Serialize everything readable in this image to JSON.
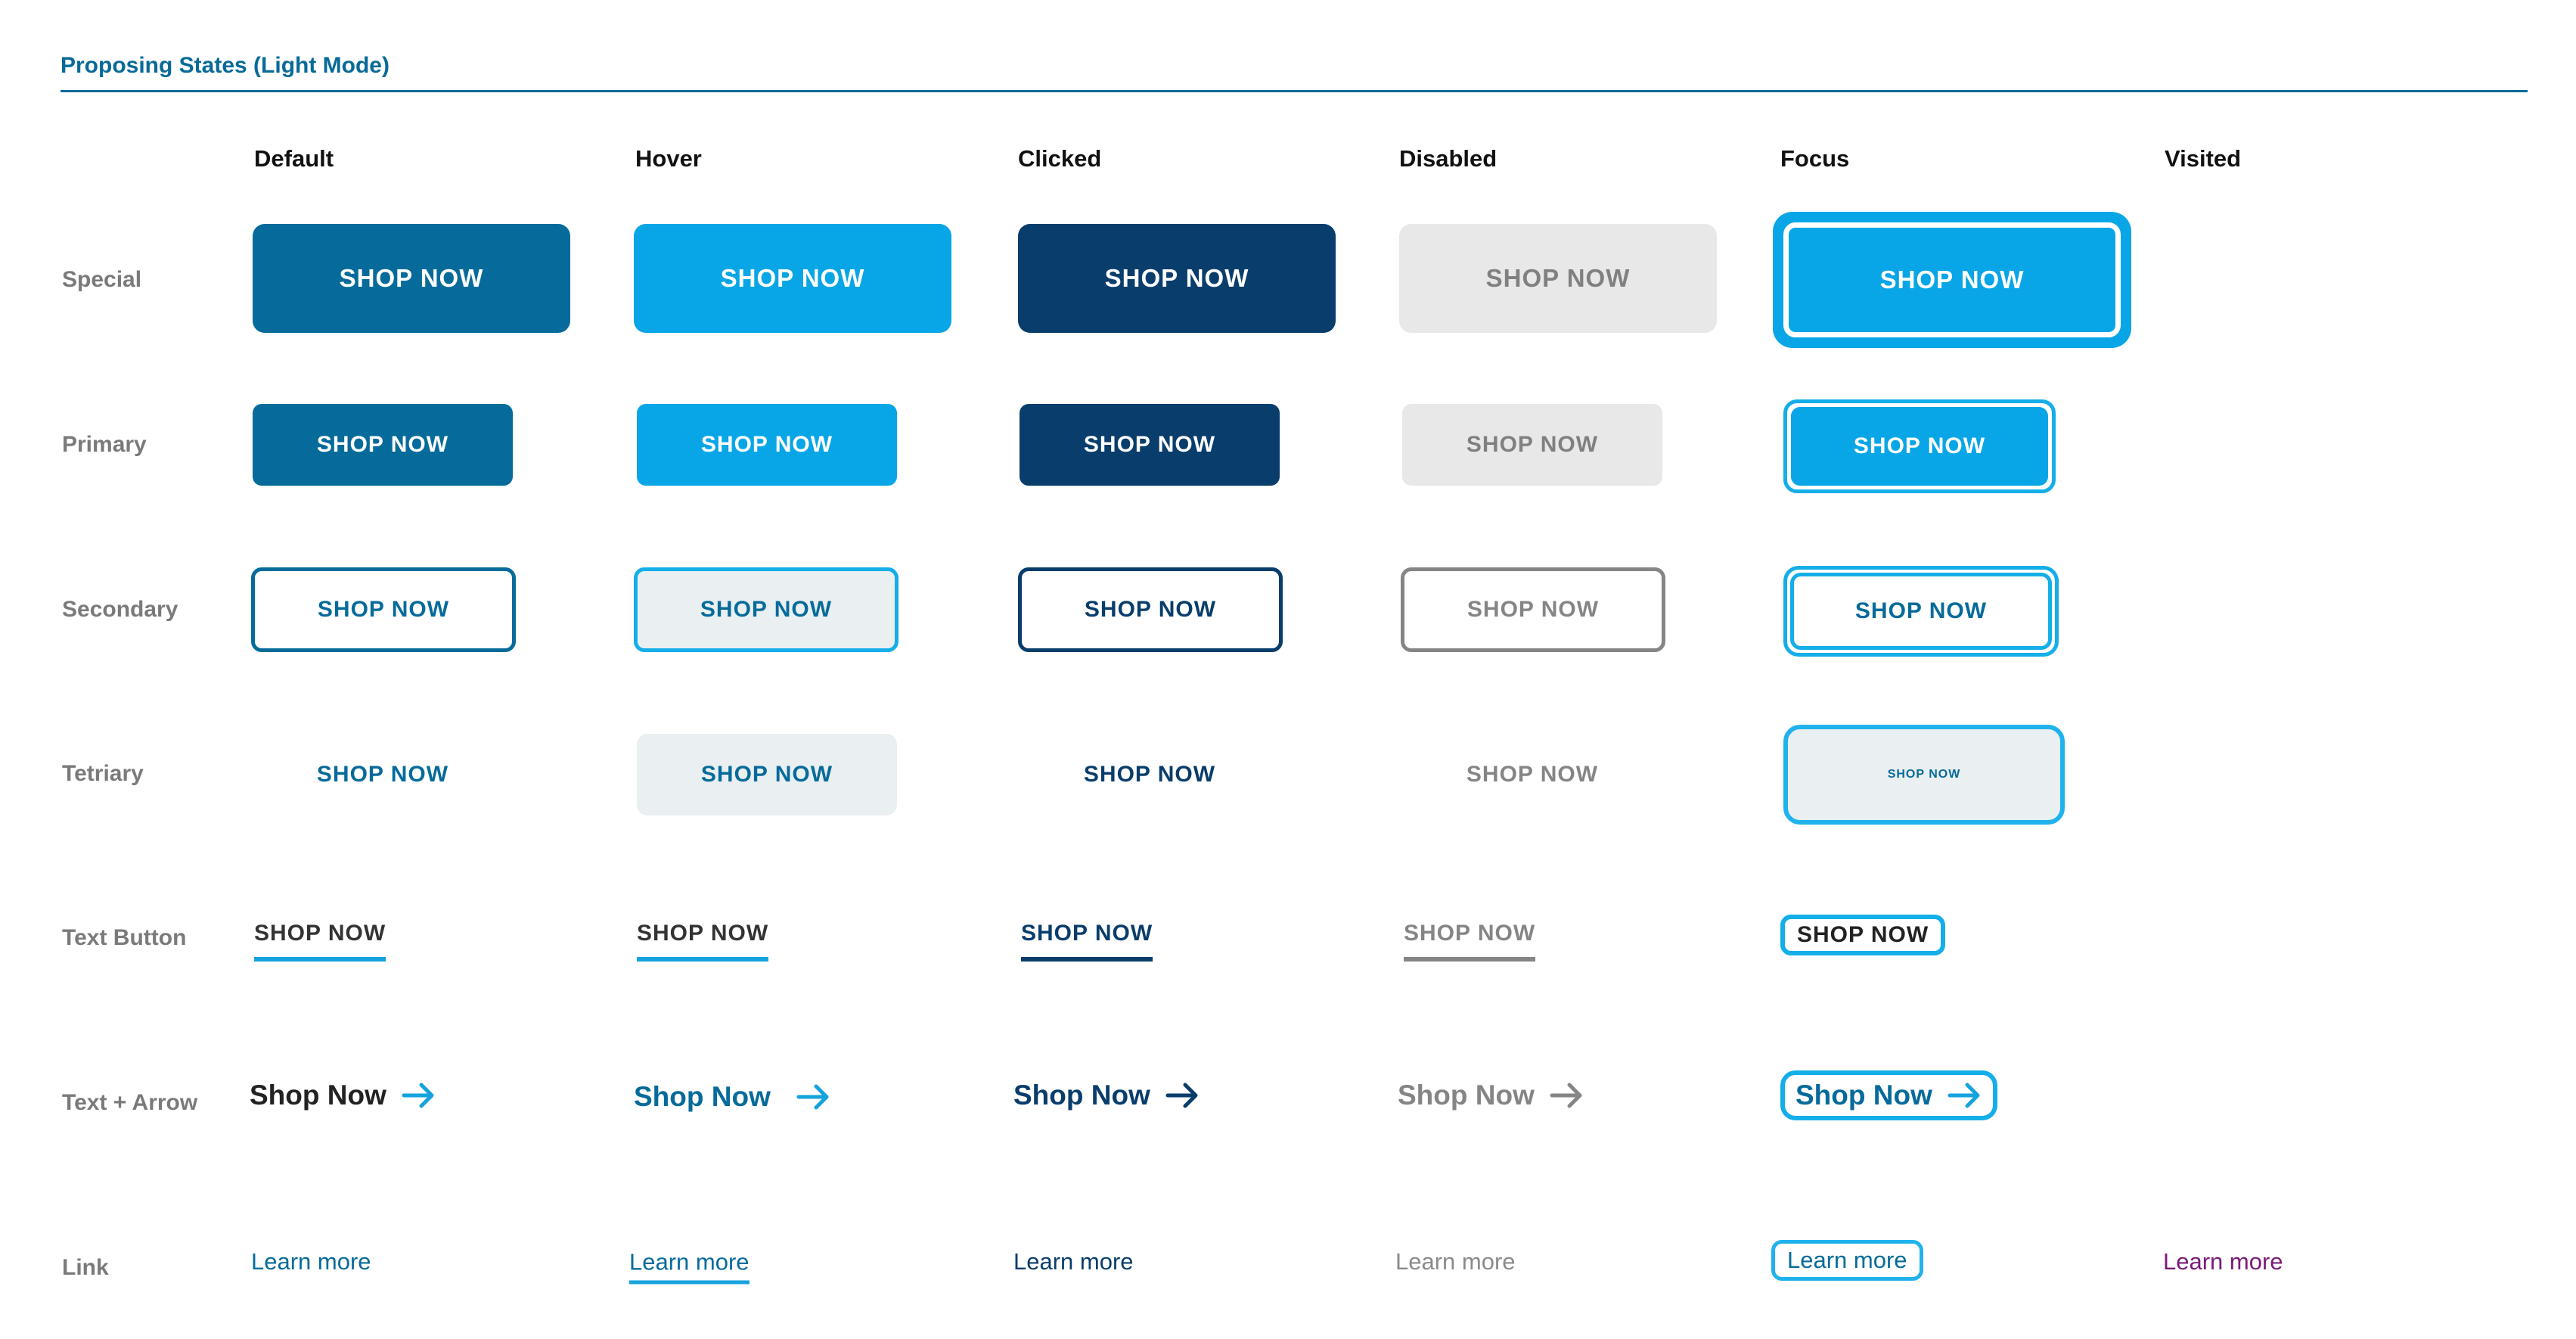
{
  "header": {
    "title": "Proposing States (Light Mode)"
  },
  "columns": [
    "Default",
    "Hover",
    "Clicked",
    "Disabled",
    "Focus",
    "Visited"
  ],
  "rows": {
    "special": {
      "label": "Special",
      "button_text": "SHOP NOW"
    },
    "primary": {
      "label": "Primary",
      "button_text": "SHOP NOW"
    },
    "secondary": {
      "label": "Secondary",
      "button_text": "SHOP NOW"
    },
    "tetriary": {
      "label": "Tetriary",
      "button_text": "SHOP NOW"
    },
    "text_button": {
      "label": "Text Button",
      "button_text": "SHOP NOW"
    },
    "text_arrow": {
      "label": "Text + Arrow",
      "button_text": "Shop Now",
      "icon": "arrow-right-icon"
    },
    "link": {
      "label": "Link",
      "link_text": "Learn more"
    }
  },
  "colors": {
    "brand": "#066b9a",
    "hover": "#08a6e6",
    "clicked": "#093d6b",
    "disabled_bg": "#e8e8e8",
    "disabled_text": "#858585",
    "focus_ring": "#14aee9",
    "tertiary_hover_bg": "#eaeff1",
    "visited": "#7a1a78",
    "row_label": "#7a7a7a"
  }
}
